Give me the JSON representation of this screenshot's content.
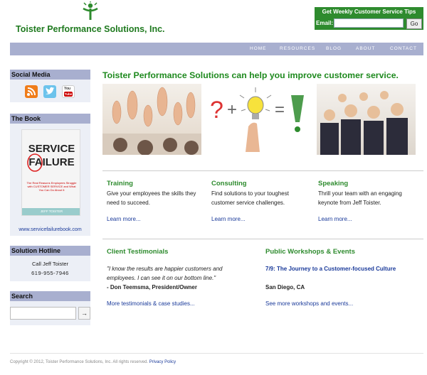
{
  "header": {
    "company_name": "Toister Performance Solutions, Inc.",
    "newsletter": {
      "title": "Get Weekly Customer Service Tips",
      "email_label": "Email:",
      "email_placeholder": "",
      "go_label": "Go"
    }
  },
  "nav": {
    "items": [
      {
        "label": "HOME",
        "active": true
      },
      {
        "label": "RESOURCES",
        "active": false
      },
      {
        "label": "BLOG",
        "active": false
      },
      {
        "label": "ABOUT",
        "active": false
      },
      {
        "label": "CONTACT",
        "active": false
      }
    ]
  },
  "sidebar": {
    "social": {
      "title": "Social Media",
      "icons": [
        "rss-icon",
        "twitter-icon",
        "youtube-icon"
      ],
      "youtube_text": "You Tube"
    },
    "book": {
      "title": "The Book",
      "cover_line1": "SERVICE",
      "cover_line2": "FAILURE",
      "cover_sub": "The Real Reasons Employees Struggle with CUSTOMER SERVICE and What You Can Do About It",
      "cover_author": "JEFF TOISTER",
      "link": "www.servicefailurebook.com"
    },
    "hotline": {
      "title": "Solution Hotline",
      "line1": "Call Jeff Toister",
      "phone": "619-955-7946"
    },
    "search": {
      "title": "Search",
      "placeholder": "",
      "button": "→"
    }
  },
  "main": {
    "heading": "Toister Performance Solutions can help you improve customer service.",
    "hero_formula": {
      "q": "?",
      "plus": "+",
      "eq": "="
    },
    "services": [
      {
        "title": "Training",
        "text": "Give your employees the skills they need to succeed.",
        "link": "Learn more..."
      },
      {
        "title": "Consulting",
        "text": "Find solutions to your toughest customer service challenges.",
        "link": "Learn more..."
      },
      {
        "title": "Speaking",
        "text": "Thrill your team with an engaging keynote from Jeff Toister.",
        "link": "Learn more..."
      }
    ],
    "testimonials": {
      "title": "Client Testimonials",
      "quote": "\"I know the results are happier customers and employees. I can see it on our bottom line.\"",
      "author": "- Don Teemsma, President/Owner",
      "link": "More testimonials & case studies..."
    },
    "workshops": {
      "title": "Public Workshops & Events",
      "event_title": "7/9: The Journey to a Customer-focused Culture",
      "event_location": "San Diego, CA",
      "link": "See more workshops and events..."
    }
  },
  "footer": {
    "copyright": "Copyright © 2012, Toister Performance Solutions, Inc. All rights reserved.",
    "privacy": "Privacy Policy"
  },
  "colors": {
    "brand_green": "#2e8b2e",
    "nav_bg": "#a8afcf",
    "link_blue": "#1a3a9a"
  }
}
